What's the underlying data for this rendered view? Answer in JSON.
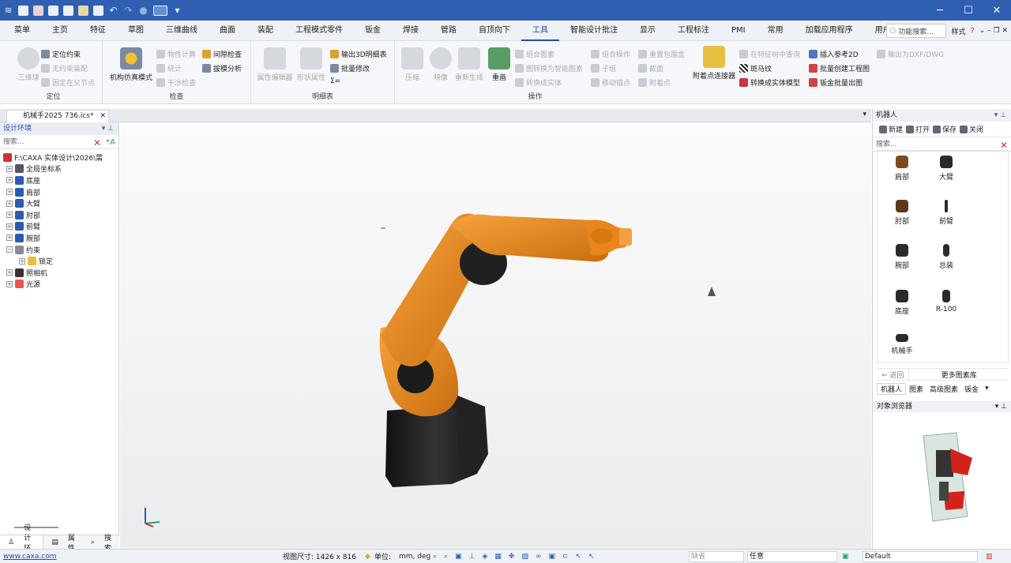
{
  "titlebar": {
    "quick_icons": [
      "logo-icon",
      "new-icon",
      "close-file-icon",
      "save-icon",
      "mail-icon",
      "open-icon",
      "save-as-icon",
      "undo-icon",
      "redo-icon",
      "settings-icon",
      "layout-icon",
      "dropdown-icon"
    ],
    "minimize": "─",
    "maximize": "☐",
    "close": "✕"
  },
  "menu": {
    "items": [
      "菜单",
      "主页",
      "特征",
      "草图",
      "三维曲线",
      "曲面",
      "装配",
      "工程模式零件",
      "钣金",
      "焊接",
      "管路",
      "自顶向下",
      "工具",
      "智能设计批注",
      "显示",
      "工程标注",
      "PMI",
      "常用",
      "加载应用程序",
      "用户中心"
    ],
    "active": "工具",
    "search_placeholder": "功能搜索...",
    "style_label": "样式"
  },
  "ribbon": {
    "positioning": {
      "label": "定位",
      "big": "三维球",
      "items": [
        "定位约束",
        "无约束装配",
        "固定在父节点"
      ]
    },
    "check": {
      "label": "检查",
      "big": "机构仿真模式",
      "items_a": [
        "物性计算",
        "统计",
        "干涉检查"
      ],
      "items_b": [
        "间隙检查",
        "拔模分析"
      ]
    },
    "bom": {
      "label": "明细表",
      "big": [
        "属性编辑器",
        "形状属性"
      ],
      "items": [
        "输出3D明细表",
        "批量修改",
        "Σ="
      ]
    },
    "operation": {
      "label": "操作",
      "big": [
        "压缩",
        "映像",
        "重新生成",
        "重画"
      ],
      "col1": [
        "组合图素",
        "图转换为智能图素",
        "转换成实体"
      ],
      "col2": [
        "组合操作",
        "子组",
        "移动锚点"
      ],
      "col3": [
        "重置包围盒",
        "截面",
        "附着点"
      ],
      "attach": "附着点连接器",
      "col4": [
        "在特征树中查询",
        "斑马纹",
        "转换成实体模型"
      ],
      "col5": [
        "插入参考2D",
        "批量创建工程图",
        "钣金批量出图"
      ],
      "col6": [
        "输出为DXF/DWG"
      ]
    }
  },
  "doc_tab": {
    "title": "机械手2025 736.ics*",
    "close": "✕"
  },
  "left_panel": {
    "title": "设计环境",
    "search_placeholder": "搜索...",
    "tree": [
      {
        "label": "F:\\CAXA 实体设计\\2026\\需",
        "level": 0
      },
      {
        "label": "全局坐标系",
        "level": 1
      },
      {
        "label": "底座",
        "level": 1
      },
      {
        "label": "肩部",
        "level": 1
      },
      {
        "label": "大臂",
        "level": 1
      },
      {
        "label": "肘部",
        "level": 1
      },
      {
        "label": "前臂",
        "level": 1
      },
      {
        "label": "腕部",
        "level": 1
      },
      {
        "label": "约束",
        "level": 1
      },
      {
        "label": "锁定",
        "level": 2
      },
      {
        "label": "照相机",
        "level": 1
      },
      {
        "label": "光源",
        "level": 1
      }
    ],
    "bottom_tabs": [
      "设计环境",
      "属性",
      "搜索"
    ]
  },
  "right_panel": {
    "title": "机器人",
    "toolbar": [
      "新建",
      "打开",
      "保存",
      "关闭"
    ],
    "search_placeholder": "搜索...",
    "library": [
      "肩部",
      "大臂",
      "肘部",
      "前臂",
      "腕部",
      "总装",
      "底座",
      "R-100",
      "机械手"
    ],
    "back": "返回",
    "more": "更多图素库",
    "tabs": [
      "机器人",
      "图素",
      "高级图素",
      "钣金"
    ],
    "object_browser": "对象浏览器"
  },
  "colors": {
    "accent": "#1f4ea5",
    "titlebar": "#2f5fb0",
    "robot_orange": "#e8861c",
    "robot_black": "#1e1e1e"
  },
  "status": {
    "link": "www.caxa.com",
    "view_size": "视图尺寸: 1426 x 816",
    "unit_label": "单位:",
    "unit_value": "mm, deg",
    "field1": "缺省",
    "field2": "任意",
    "default": "Default"
  }
}
